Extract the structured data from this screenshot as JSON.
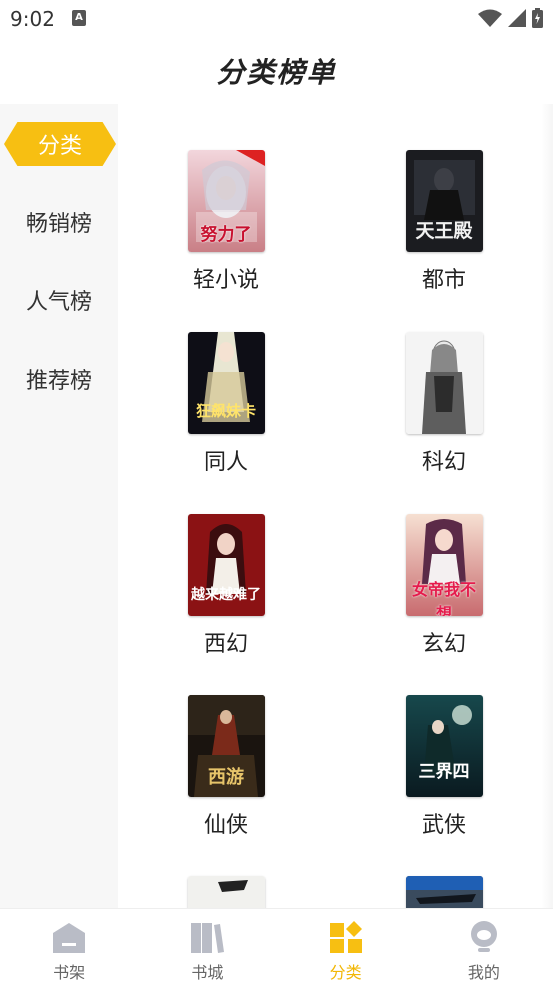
{
  "status_bar": {
    "time": "9:02",
    "notif_letter": "A"
  },
  "header": {
    "title": "分类榜单"
  },
  "sidebar": {
    "items": [
      {
        "label": "分类",
        "active": true
      },
      {
        "label": "畅销榜",
        "active": false
      },
      {
        "label": "人气榜",
        "active": false
      },
      {
        "label": "推荐榜",
        "active": false
      }
    ]
  },
  "categories": [
    {
      "label": "轻小说",
      "cover_text": "努力了"
    },
    {
      "label": "都市",
      "cover_text": "天王殿"
    },
    {
      "label": "同人",
      "cover_text": "狂飙妹卡"
    },
    {
      "label": "科幻",
      "cover_text": ""
    },
    {
      "label": "西幻",
      "cover_text": "越来越难了"
    },
    {
      "label": "玄幻",
      "cover_text": "女帝我不想"
    },
    {
      "label": "仙侠",
      "cover_text": "西游"
    },
    {
      "label": "武侠",
      "cover_text": "三界四"
    }
  ],
  "bottom_nav": {
    "tabs": [
      {
        "label": "书架",
        "icon": "bookshelf-icon"
      },
      {
        "label": "书城",
        "icon": "bookstore-icon"
      },
      {
        "label": "分类",
        "icon": "category-icon",
        "active": true
      },
      {
        "label": "我的",
        "icon": "profile-icon"
      }
    ]
  },
  "colors": {
    "accent": "#f7bf12",
    "sidebar_bg": "#f7f7f7"
  }
}
